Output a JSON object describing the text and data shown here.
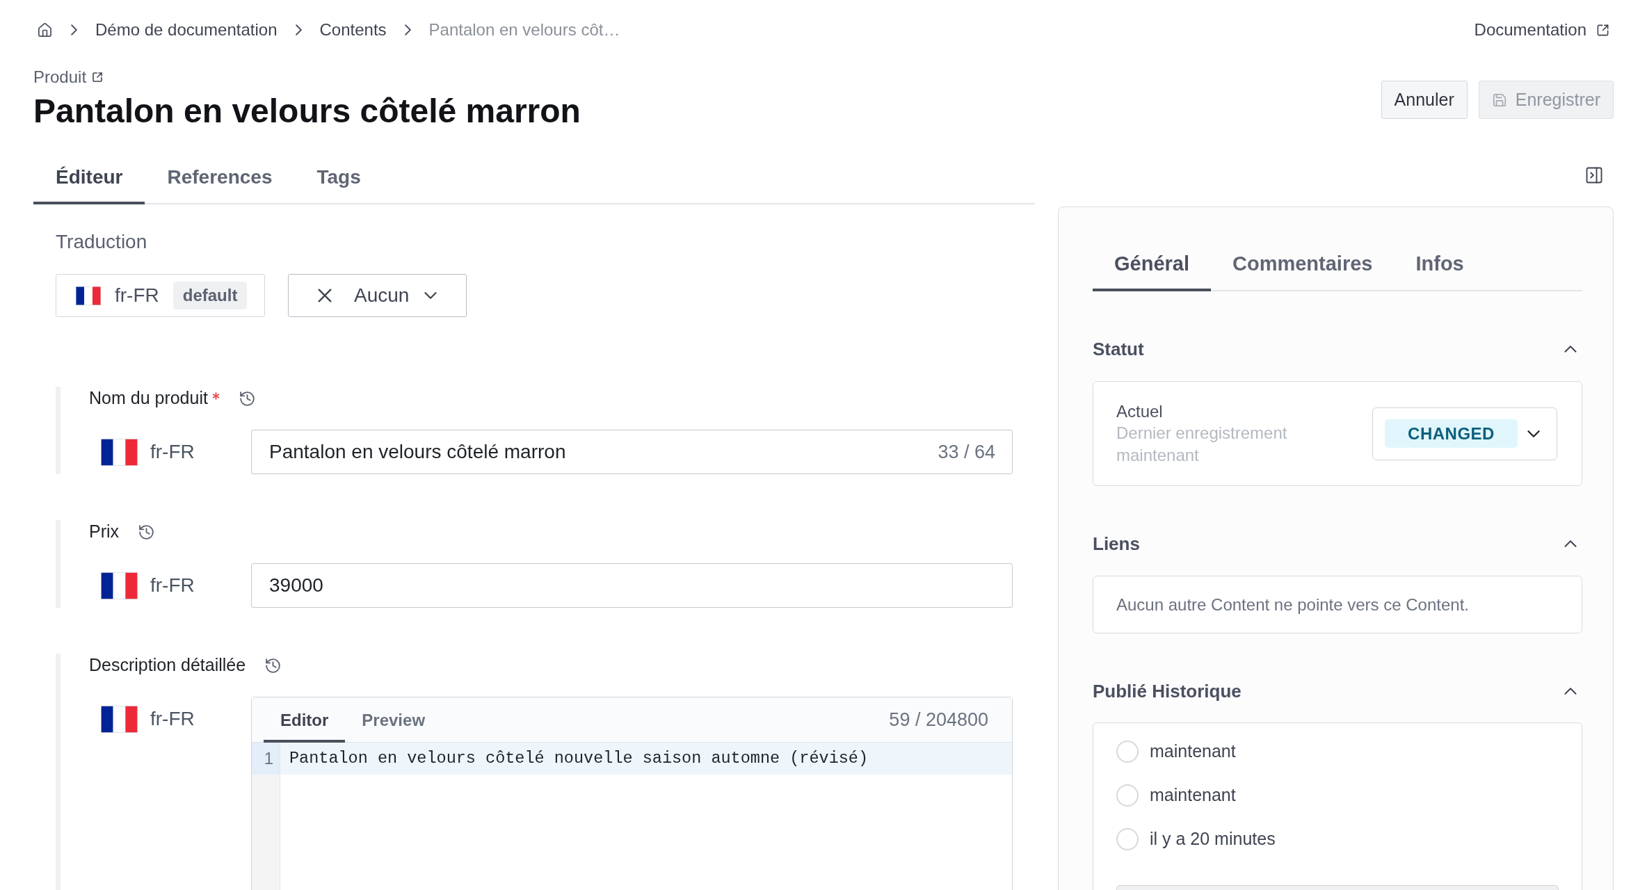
{
  "breadcrumb": {
    "items": [
      {
        "label": "Démo de documentation",
        "current": false
      },
      {
        "label": "Contents",
        "current": false
      },
      {
        "label": "Pantalon en velours côt…",
        "current": true
      }
    ]
  },
  "header_link": {
    "label": "Documentation"
  },
  "page": {
    "type_label": "Produit",
    "title": "Pantalon en velours côtelé marron"
  },
  "actions": [
    {
      "label": "Annuler",
      "disabled": false,
      "kind": "cancel"
    },
    {
      "label": "Enregistrer",
      "disabled": true,
      "kind": "save"
    }
  ],
  "tabs": [
    {
      "label": "Éditeur",
      "selected": true
    },
    {
      "label": "References",
      "selected": false
    },
    {
      "label": "Tags",
      "selected": false
    }
  ],
  "translation": {
    "label": "Traduction",
    "locale": "fr-FR",
    "locale_badge": "default",
    "compare_value": "Aucun"
  },
  "fields": [
    {
      "kind": "text",
      "label": "Nom du produit",
      "required": true,
      "locale": "fr-FR",
      "value": "Pantalon en velours côtelé marron",
      "counter": "33 / 64"
    },
    {
      "kind": "text",
      "label": "Prix",
      "required": false,
      "locale": "fr-FR",
      "value": "39000"
    },
    {
      "kind": "markdown",
      "label": "Description détaillée",
      "required": false,
      "locale": "fr-FR",
      "editor_tabs": [
        {
          "label": "Editor",
          "selected": true
        },
        {
          "label": "Preview",
          "selected": false
        }
      ],
      "counter": "59 / 204800",
      "lines": [
        {
          "number": "1",
          "text": "Pantalon en velours côtelé nouvelle saison automne (révisé)",
          "active": true
        }
      ]
    }
  ],
  "sidebar": {
    "tabs": [
      {
        "label": "Général",
        "selected": true
      },
      {
        "label": "Commentaires",
        "selected": false
      },
      {
        "label": "Infos",
        "selected": false
      }
    ],
    "sections": [
      {
        "kind": "status",
        "title": "Statut",
        "expanded": true,
        "label": "Actuel",
        "detail": "Dernier enregistrement maintenant",
        "status": "CHANGED"
      },
      {
        "kind": "links",
        "title": "Liens",
        "expanded": true,
        "empty_text": "Aucun autre Content ne pointe vers ce Content."
      },
      {
        "kind": "history",
        "title": "Publié Historique",
        "expanded": true,
        "items": [
          {
            "label": "maintenant",
            "selected": false
          },
          {
            "label": "maintenant",
            "selected": false
          },
          {
            "label": "il y a 20 minutes",
            "selected": false
          }
        ]
      }
    ]
  }
}
